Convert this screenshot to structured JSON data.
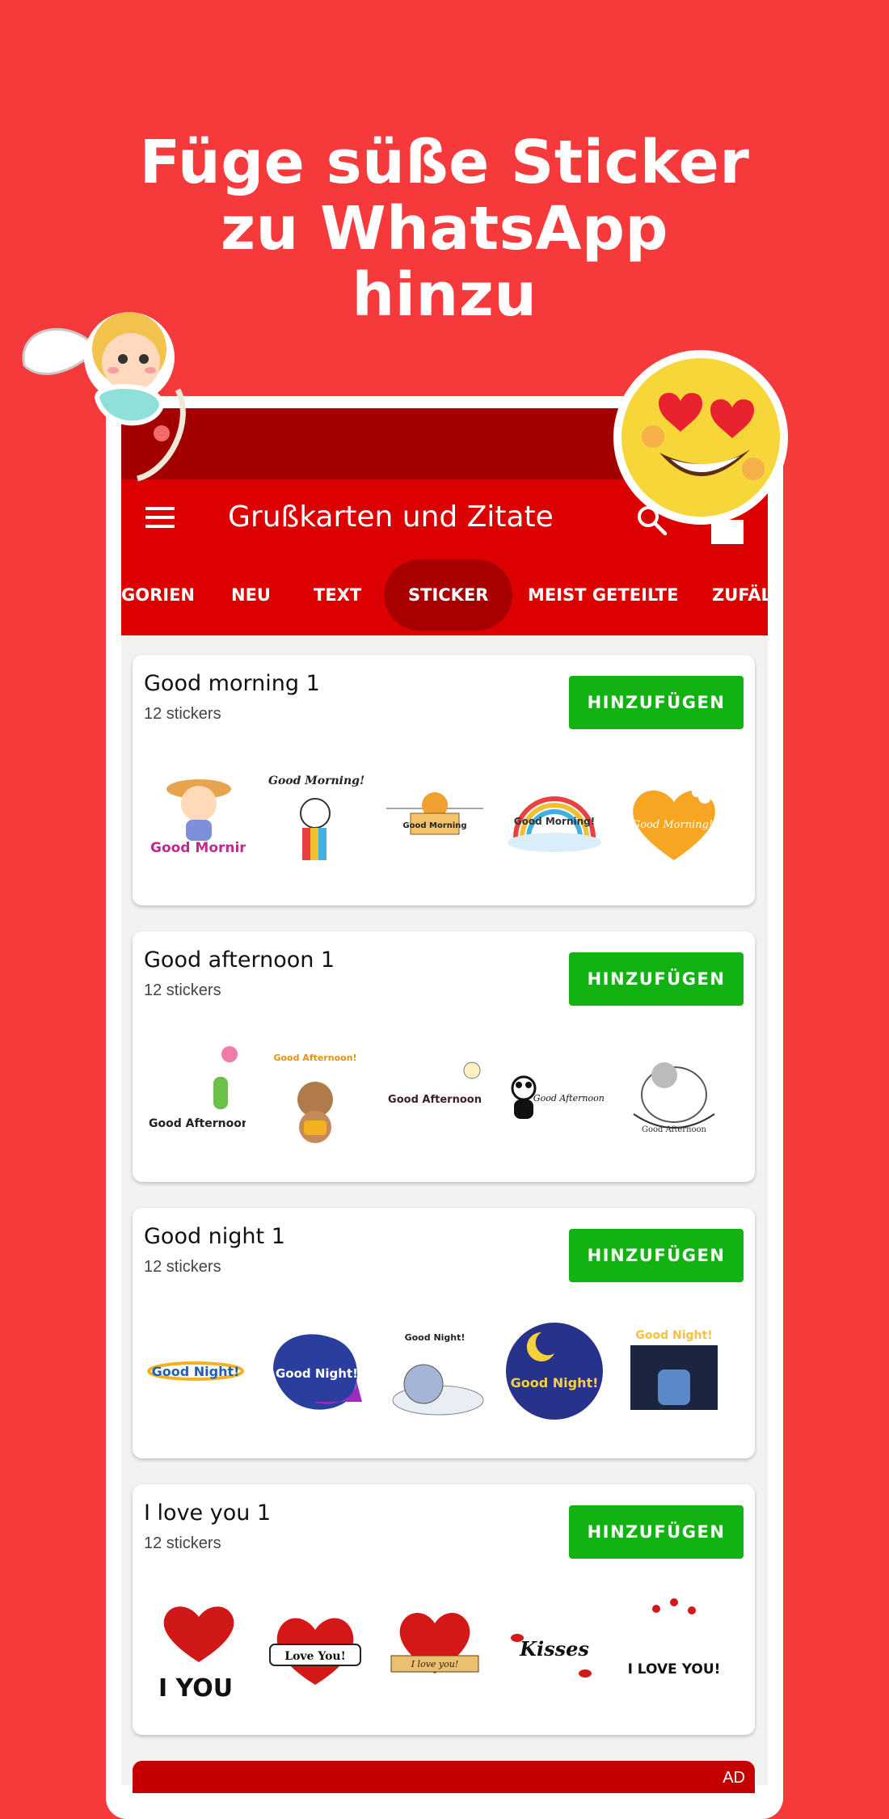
{
  "headline": {
    "line1": "Füge süße Sticker",
    "line2": "zu WhatsApp",
    "line3": "hinzu"
  },
  "appbar": {
    "title": "Grußkarten und Zitate",
    "menu_icon": "hamburger-menu-icon",
    "search_icon": "search-icon",
    "share_icon": "share-icon"
  },
  "tabs": [
    "GORIEN",
    "NEU",
    "TEXT",
    "STICKER",
    "MEIST GETEILTE",
    "ZUFÄLL"
  ],
  "active_tab": "STICKER",
  "cards": [
    {
      "title": "Good morning 1",
      "count": "12 stickers",
      "button": "HINZUFÜGEN",
      "stickers": [
        "Good Morning!",
        "Good Morning!",
        "Good Morning",
        "Good Morning!",
        "Good Morning!"
      ]
    },
    {
      "title": "Good afternoon 1",
      "count": "12 stickers",
      "button": "HINZUFÜGEN",
      "stickers": [
        "Good Afternoon",
        "Good Afternoon!",
        "Good Afternoon",
        "Good Afternoon!",
        "Good Afternoon"
      ]
    },
    {
      "title": "Good night 1",
      "count": "12 stickers",
      "button": "HINZUFÜGEN",
      "stickers": [
        "Good Night!",
        "Good Night!",
        "Good Night!",
        "Good Night!",
        "Good Night!"
      ]
    },
    {
      "title": "I love you 1",
      "count": "12 stickers",
      "button": "HINZUFÜGEN",
      "stickers": [
        "I YOU",
        "Love You!",
        "I love you!",
        "Kisses",
        "I LOVE YOU!"
      ]
    }
  ],
  "ad": {
    "label": "AD"
  },
  "colors": {
    "background": "#f63a3c",
    "appbar": "#dd0000",
    "statusbar": "#a30000",
    "button": "#13b213"
  }
}
